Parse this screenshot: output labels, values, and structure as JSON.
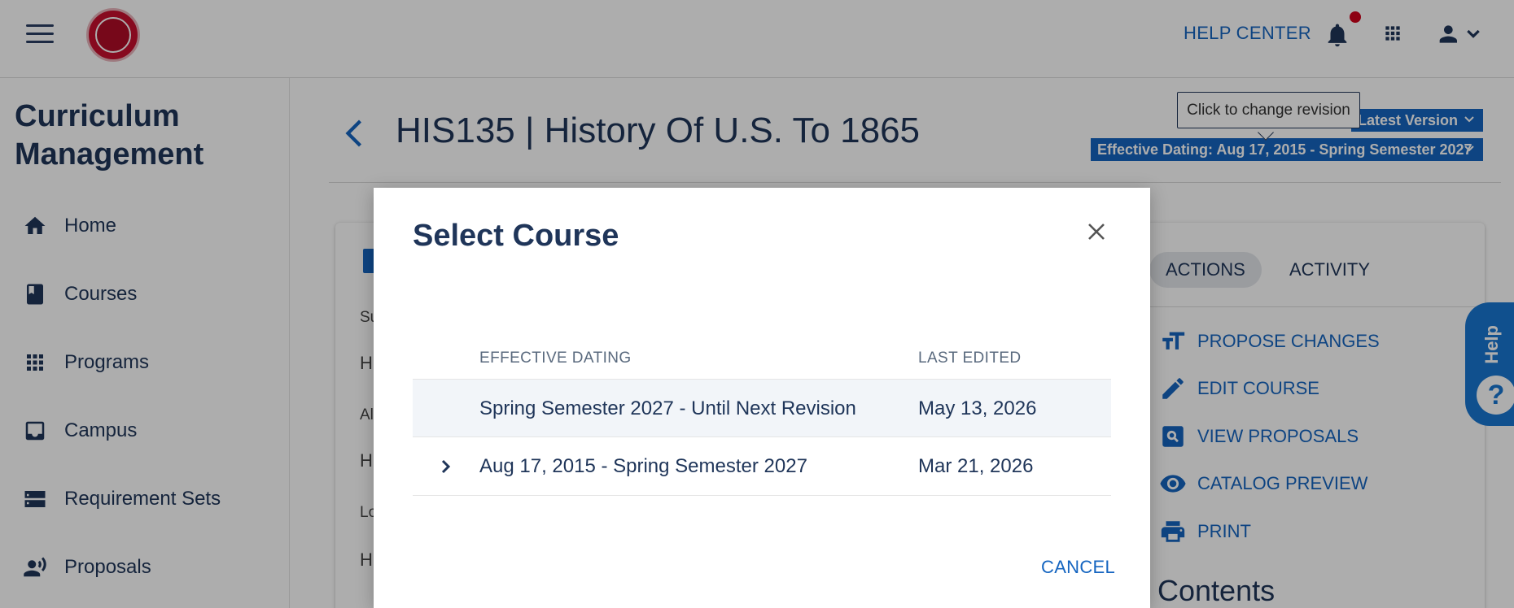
{
  "header": {
    "help_center": "HELP CENTER",
    "logo_name": "university-seal-logo",
    "icons": [
      "menu-icon",
      "bell-icon",
      "apps-grid-icon",
      "user-icon",
      "chevron-down-icon"
    ],
    "accent_color": "#1565c0",
    "notification_color": "#d0021b"
  },
  "sidebar": {
    "title": "Curriculum Management",
    "items": [
      {
        "label": "Home",
        "icon": "home-icon"
      },
      {
        "label": "Courses",
        "icon": "book-icon"
      },
      {
        "label": "Programs",
        "icon": "grid-icon"
      },
      {
        "label": "Campus",
        "icon": "inbox-icon"
      },
      {
        "label": "Requirement Sets",
        "icon": "storage-icon"
      },
      {
        "label": "Proposals",
        "icon": "speaker-person-icon"
      }
    ]
  },
  "main": {
    "course_title": "HIS135 | History Of U.S. To 1865",
    "tooltip": "Click to change revision",
    "revision_latest": "Latest Version",
    "revision_dating": "Effective Dating: Aug 17, 2015 - Spring Semester 2027",
    "fragments": [
      "Su",
      "H",
      "Al",
      "H",
      "Lo",
      "H"
    ],
    "tabs": [
      "ACTIONS",
      "ACTIVITY"
    ],
    "actions": [
      {
        "label": "PROPOSE CHANGES",
        "icon": "text-size-icon"
      },
      {
        "label": "EDIT COURSE",
        "icon": "pencil-icon"
      },
      {
        "label": "VIEW PROPOSALS",
        "icon": "search-box-icon"
      },
      {
        "label": "CATALOG PREVIEW",
        "icon": "eye-icon"
      },
      {
        "label": "PRINT",
        "icon": "printer-icon"
      }
    ],
    "contents_heading": "Contents",
    "help_tab": "Help",
    "help_tab_glyph": "?"
  },
  "modal": {
    "title": "Select Course",
    "columns": [
      "EFFECTIVE DATING",
      "LAST EDITED"
    ],
    "rows": [
      {
        "dating": "Spring Semester 2027 - Until Next Revision",
        "edited": "May 13, 2026",
        "expandable": false
      },
      {
        "dating": "Aug 17, 2015 - Spring Semester 2027",
        "edited": "Mar 21, 2026",
        "expandable": true
      }
    ],
    "cancel": "CANCEL"
  }
}
